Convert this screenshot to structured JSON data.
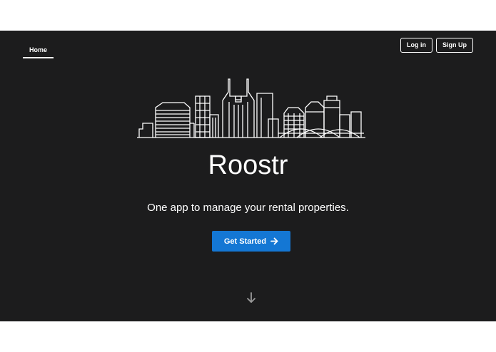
{
  "nav": {
    "home_label": "Home"
  },
  "auth": {
    "login_label": "Log in",
    "signup_label": "Sign Up"
  },
  "hero": {
    "title": "Roostr",
    "tagline": "One app to manage your rental properties.",
    "cta_label": "Get Started",
    "cta_icon": "arrow-right-icon",
    "scroll_icon": "arrow-down-icon",
    "skyline_icon": "city-skyline-icon"
  },
  "colors": {
    "background": "#1c1c1d",
    "page": "#ffffff",
    "accent": "#1477d4",
    "text": "#ffffff",
    "scroll_arrow": "#9a9a9a"
  }
}
